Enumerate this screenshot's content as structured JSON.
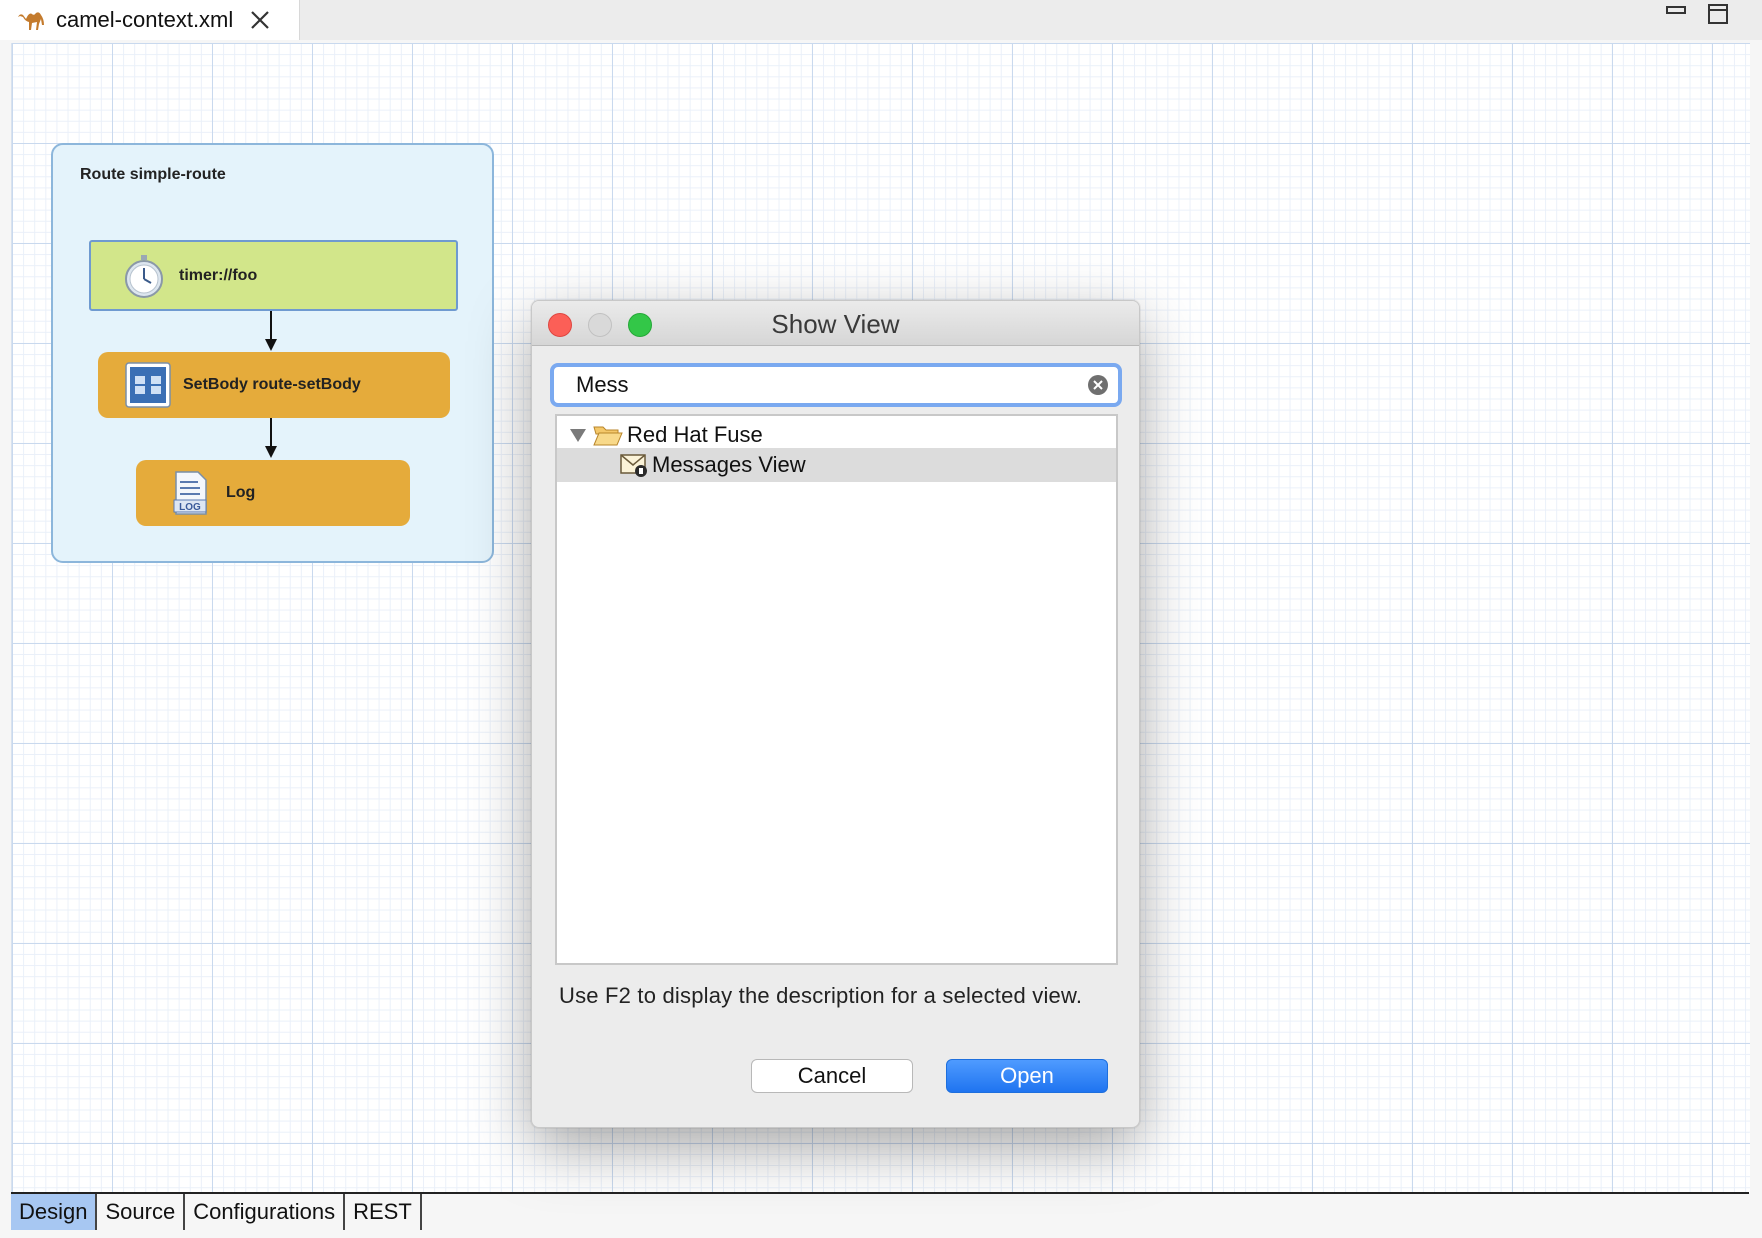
{
  "editor": {
    "tab_title": "camel-context.xml"
  },
  "route": {
    "title": "Route simple-route",
    "nodes": [
      {
        "label": "timer://foo",
        "icon": "stopwatch-icon",
        "color": "#d2e68a"
      },
      {
        "label": "SetBody route-setBody",
        "icon": "setbody-icon",
        "color": "#e5ab3b"
      },
      {
        "label": "Log",
        "icon": "log-icon",
        "color": "#e5ab3b"
      }
    ]
  },
  "dialog": {
    "title": "Show View",
    "search_value": "Mess",
    "tree": {
      "folder_label": "Red Hat Fuse",
      "item_label": "Messages View"
    },
    "hint": "Use F2 to display the description for a selected view.",
    "cancel_label": "Cancel",
    "open_label": "Open"
  },
  "bottom_tabs": {
    "design": "Design",
    "source": "Source",
    "configurations": "Configurations",
    "rest": "REST"
  },
  "colors": {
    "accent": "#1f74f0",
    "route_bg": "#e4f3fb",
    "processor": "#e5ab3b",
    "endpoint": "#d2e68a"
  }
}
